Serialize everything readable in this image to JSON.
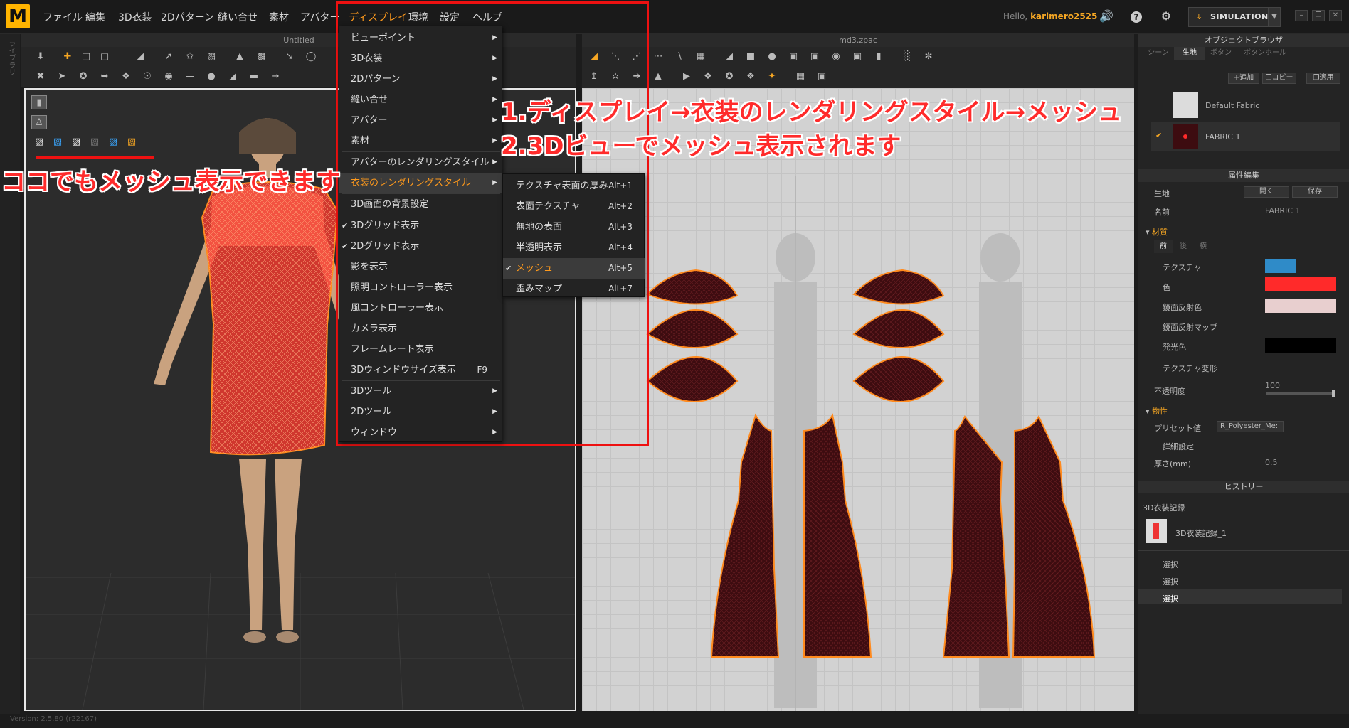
{
  "menubar": {
    "logo": "M",
    "items": [
      "ファイル",
      "編集",
      "3D衣装",
      "2Dパターン",
      "縫い合せ",
      "素材",
      "アバター",
      "ディスプレイ",
      "環境",
      "設定",
      "ヘルプ"
    ],
    "active_item": "ディスプレイ",
    "hello_label": "Hello,",
    "user": "karimero2525",
    "simulation_label": "SIMULATION"
  },
  "left_strip": {
    "label": "ライブラリ"
  },
  "view3d": {
    "title": "Untitled"
  },
  "view2d": {
    "title": "md3.zpac"
  },
  "display_menu": {
    "items": [
      {
        "label": "ビューポイント",
        "arrow": true
      },
      {
        "label": "3D衣装",
        "arrow": true
      },
      {
        "label": "2Dパターン",
        "arrow": true
      },
      {
        "label": "縫い合せ",
        "arrow": true
      },
      {
        "label": "アバター",
        "arrow": true
      },
      {
        "label": "素材",
        "arrow": true
      },
      {
        "label": "アバターのレンダリングスタイル",
        "arrow": true
      },
      {
        "label": "衣装のレンダリングスタイル",
        "arrow": true,
        "highlighted": true
      },
      {
        "label": "3D画面の背景設定"
      },
      {
        "label": "3Dグリッド表示",
        "checked": true
      },
      {
        "label": "2Dグリッド表示",
        "checked": true
      },
      {
        "label": "影を表示"
      },
      {
        "label": "照明コントローラー表示"
      },
      {
        "label": "風コントローラー表示"
      },
      {
        "label": "カメラ表示"
      },
      {
        "label": "フレームレート表示"
      },
      {
        "label": "3Dウィンドウサイズ表示",
        "shortcut": "F9"
      },
      {
        "label": "3Dツール",
        "arrow": true
      },
      {
        "label": "2Dツール",
        "arrow": true
      },
      {
        "label": "ウィンドウ",
        "arrow": true
      }
    ]
  },
  "render_submenu": {
    "items": [
      {
        "label": "テクスチャ表面の厚み",
        "shortcut": "Alt+1"
      },
      {
        "label": "表面テクスチャ",
        "shortcut": "Alt+2"
      },
      {
        "label": "無地の表面",
        "shortcut": "Alt+3"
      },
      {
        "label": "半透明表示",
        "shortcut": "Alt+4"
      },
      {
        "label": "メッシュ",
        "shortcut": "Alt+5",
        "checked": true,
        "highlighted": true
      },
      {
        "label": "歪みマップ",
        "shortcut": "Alt+7"
      }
    ]
  },
  "annotations": {
    "line1": "1.ディスプレイ→衣装のレンダリングスタイル→メッシュ",
    "line2": "2.3Dビューでメッシュ表示されます",
    "left_note": "ココでもメッシュ表示できます"
  },
  "object_browser": {
    "title": "オブジェクトブラウザ",
    "tabs": [
      "シーン",
      "生地",
      "ボタン",
      "ボタンホール"
    ],
    "active_tab": "生地",
    "add_label": "追加",
    "copy_label": "コピー",
    "apply_label": "適用",
    "fabrics": [
      {
        "name": "Default Fabric"
      },
      {
        "name": "FABRIC 1",
        "selected": true
      }
    ]
  },
  "property_editor": {
    "title": "属性編集",
    "fabric_label": "生地",
    "open_label": "開く",
    "save_label": "保存",
    "name_label": "名前",
    "name_value": "FABRIC 1",
    "material_section": "材質",
    "material_tabs": [
      "前",
      "後",
      "横"
    ],
    "texture_label": "テクスチャ",
    "color_label": "色",
    "color_value": "#ff2a2a",
    "specular_label": "鏡面反射色",
    "specular_value": "#e8cfcf",
    "specular_map_label": "鏡面反射マップ",
    "emission_label": "発光色",
    "emission_value": "#000000",
    "texture_transform_label": "テクスチャ変形",
    "opacity_label": "不透明度",
    "opacity_value": "100",
    "physical_section": "物性",
    "preset_label": "プリセット値",
    "preset_value": "R_Polyester_Me:",
    "detail_label": "詳細設定",
    "thickness_label": "厚さ(mm)",
    "thickness_value": "0.5"
  },
  "history": {
    "title": "ヒストリー",
    "section": "3D衣装記録",
    "entry": "3D衣装記録_1",
    "rows": [
      "選択",
      "選択",
      "選択"
    ]
  },
  "status": {
    "version": "Version: 2.5.80    (r22167)"
  }
}
